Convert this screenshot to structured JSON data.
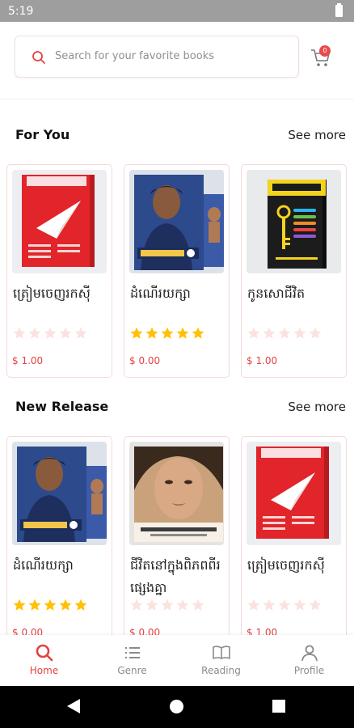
{
  "status_bar": {
    "time": "5:19"
  },
  "header": {
    "search_placeholder": "Search for your favorite books",
    "cart_badge": "0"
  },
  "sections": [
    {
      "title": "For You",
      "see_more": "See more",
      "books": [
        {
          "title": "ត្រៀមចេញរកស៊ី",
          "price": "$ 1.00",
          "rating": 0
        },
        {
          "title": "ដំណើរយក្សា",
          "price": "$ 0.00",
          "rating": 5
        },
        {
          "title": "កូនសោជីវិត",
          "price": "$ 1.00",
          "rating": 0
        }
      ]
    },
    {
      "title": "New Release",
      "see_more": "See more",
      "books": [
        {
          "title": "ដំណើរយក្សា",
          "price": "$ 0.00",
          "rating": 5
        },
        {
          "title": "ជីវិតនៅក្នុងពិភពពីរផ្សេងគ្នា",
          "price": "$ 0.00",
          "rating": 0
        },
        {
          "title": "ត្រៀមចេញរកស៊ី",
          "price": "$ 1.00",
          "rating": 0
        }
      ]
    }
  ],
  "bottom_nav": {
    "home": "Home",
    "genre": "Genre",
    "reading": "Reading",
    "profile": "Profile"
  },
  "colors": {
    "accent": "#e34141",
    "star_on": "#ffc107",
    "star_off": "#fde1e1"
  }
}
